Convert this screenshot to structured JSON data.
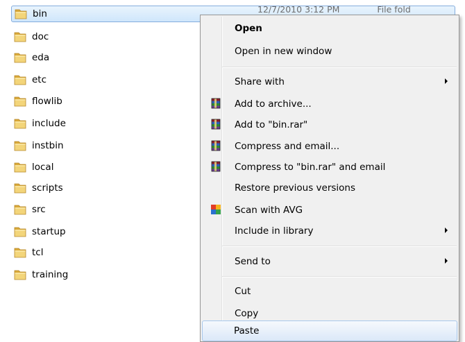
{
  "files": [
    {
      "name": "bin",
      "date": "12/7/2010 3:12 PM",
      "type": "File fold"
    },
    {
      "name": "doc"
    },
    {
      "name": "eda"
    },
    {
      "name": "etc"
    },
    {
      "name": "flowlib"
    },
    {
      "name": "include"
    },
    {
      "name": "instbin"
    },
    {
      "name": "local"
    },
    {
      "name": "scripts"
    },
    {
      "name": "src"
    },
    {
      "name": "startup"
    },
    {
      "name": "tcl"
    },
    {
      "name": "training"
    }
  ],
  "menu": {
    "open": "Open",
    "open_new_window": "Open in new window",
    "share_with": "Share with",
    "add_to_archive": "Add to archive...",
    "add_to_rar": "Add to \"bin.rar\"",
    "compress_email": "Compress and email...",
    "compress_rar_email": "Compress to \"bin.rar\" and email",
    "restore_versions": "Restore previous versions",
    "scan_avg": "Scan with AVG",
    "include_library": "Include in library",
    "send_to": "Send to",
    "cut": "Cut",
    "copy": "Copy",
    "paste": "Paste"
  },
  "icons": {
    "folder": "folder-icon",
    "archive": "winrar-icon",
    "avg": "avg-icon",
    "submenu": "chevron-right-icon"
  },
  "colors": {
    "selection": "#cfe6fb",
    "menu_background": "#f0f0f0",
    "folder_yellow": "#e8c25a"
  }
}
